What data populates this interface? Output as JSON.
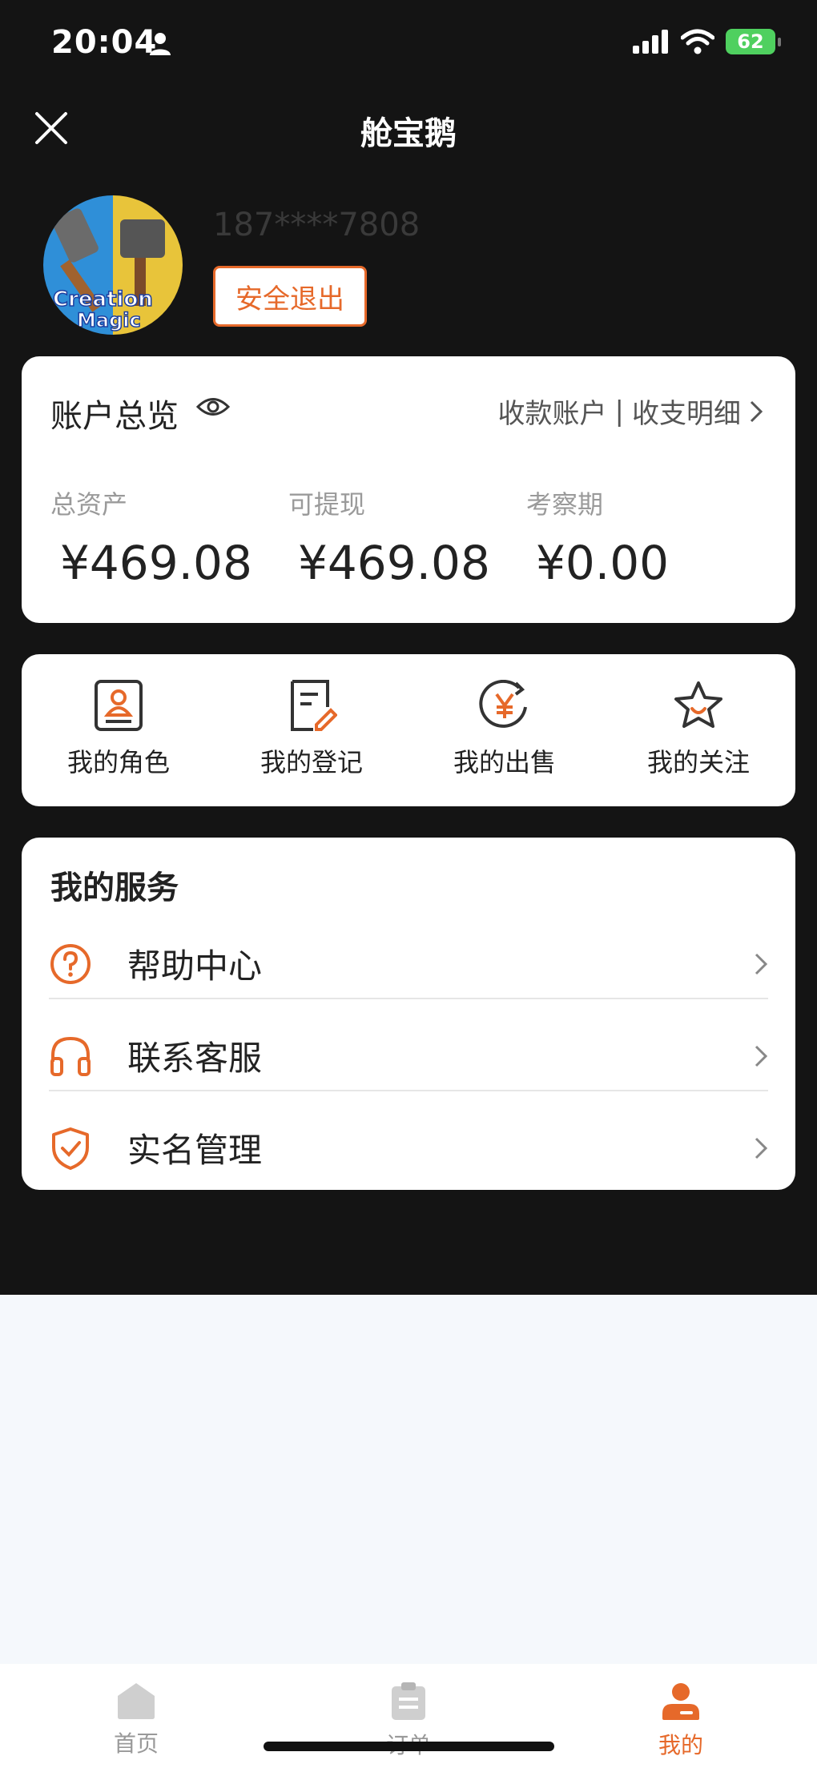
{
  "status_bar": {
    "time": "20:04",
    "battery": "62"
  },
  "nav": {
    "title": "舱宝鹅"
  },
  "profile": {
    "avatar_text_line1": "Creation",
    "avatar_text_line2": "Magic",
    "phone": "187****7808",
    "logout_label": "安全退出"
  },
  "account": {
    "title": "账户总览",
    "link_receive": "收款账户",
    "link_separator": "|",
    "link_statement": "收支明细",
    "stats": [
      {
        "label": "总资产",
        "value": "¥469.08"
      },
      {
        "label": "可提现",
        "value": "¥469.08"
      },
      {
        "label": "考察期",
        "value": "¥0.00"
      }
    ]
  },
  "shortcuts": [
    {
      "label": "我的角色",
      "icon": "role-card-icon"
    },
    {
      "label": "我的登记",
      "icon": "register-edit-icon"
    },
    {
      "label": "我的出售",
      "icon": "yen-sell-icon"
    },
    {
      "label": "我的关注",
      "icon": "star-follow-icon"
    }
  ],
  "services": {
    "title": "我的服务",
    "items": [
      {
        "label": "帮助中心",
        "icon": "question-circle-icon"
      },
      {
        "label": "联系客服",
        "icon": "headset-icon"
      },
      {
        "label": "实名管理",
        "icon": "shield-check-icon"
      }
    ]
  },
  "tabbar": {
    "items": [
      {
        "label": "首页",
        "icon": "home-icon",
        "active": false
      },
      {
        "label": "订单",
        "icon": "clipboard-icon",
        "active": false
      },
      {
        "label": "我的",
        "icon": "user-icon",
        "active": true
      }
    ]
  },
  "colors": {
    "accent": "#e6692a",
    "dark_bg": "#141414",
    "page_bg": "#f5f8fc"
  }
}
